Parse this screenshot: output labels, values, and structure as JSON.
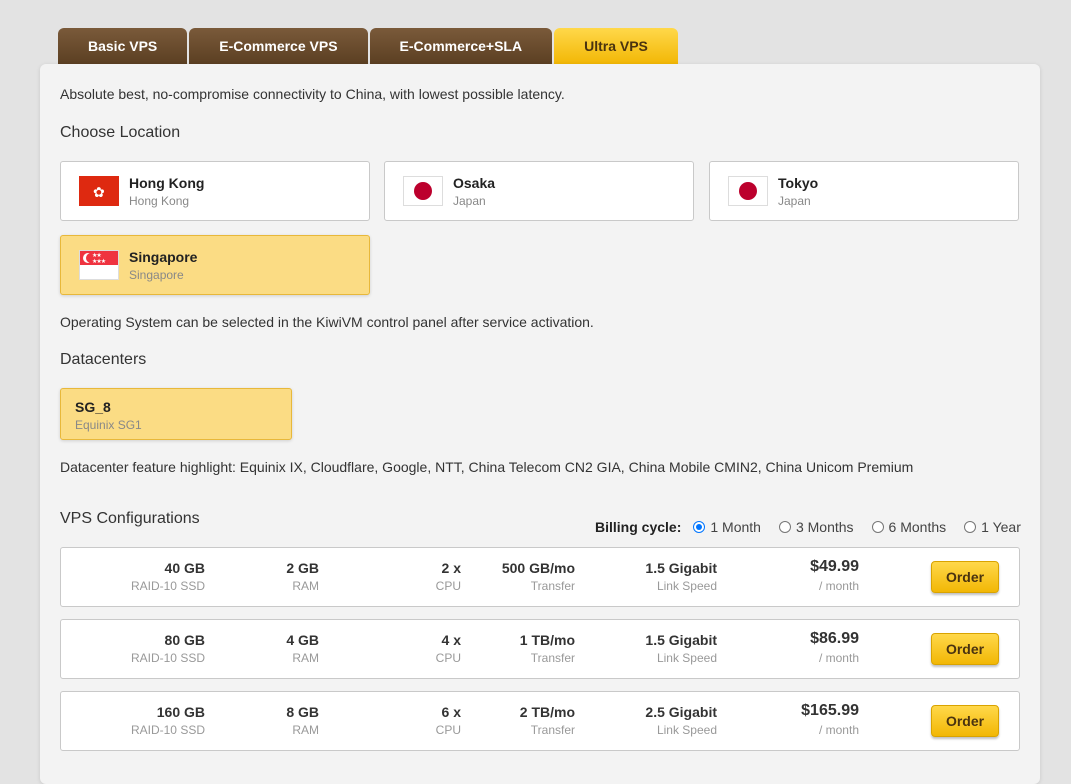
{
  "tabs": [
    {
      "label": "Basic VPS"
    },
    {
      "label": "E-Commerce VPS"
    },
    {
      "label": "E-Commerce+SLA"
    },
    {
      "label": "Ultra VPS",
      "active": true
    }
  ],
  "description": "Absolute best, no-compromise connectivity to China, with lowest possible latency.",
  "location_title": "Choose Location",
  "locations": [
    {
      "name": "Hong Kong",
      "sub": "Hong Kong",
      "flag": "hong-kong-flag"
    },
    {
      "name": "Osaka",
      "sub": "Japan",
      "flag": "japan-flag"
    },
    {
      "name": "Tokyo",
      "sub": "Japan",
      "flag": "japan-flag"
    },
    {
      "name": "Singapore",
      "sub": "Singapore",
      "flag": "singapore-flag",
      "selected": true
    }
  ],
  "os_note": "Operating System can be selected in the KiwiVM control panel after service activation.",
  "datacenters_title": "Datacenters",
  "datacenter": {
    "name": "SG_8",
    "sub": "Equinix SG1",
    "selected": true
  },
  "dc_note": "Datacenter feature highlight: Equinix IX, Cloudflare, Google, NTT, China Telecom CN2 GIA, China Mobile CMIN2, China Unicom Premium",
  "configs_title": "VPS Configurations",
  "billing": {
    "label": "Billing cycle:",
    "options": [
      "1 Month",
      "3 Months",
      "6 Months",
      "1 Year"
    ],
    "selected": "1 Month"
  },
  "config_labels": {
    "disk": "RAID-10 SSD",
    "ram": "RAM",
    "cpu": "CPU",
    "transfer": "Transfer",
    "link": "Link Speed",
    "per": "/ month",
    "order": "Order"
  },
  "configs": [
    {
      "disk": "40 GB",
      "ram": "2 GB",
      "cpu": "2 x",
      "transfer": "500 GB/mo",
      "link": "1.5 Gigabit",
      "price": "$49.99"
    },
    {
      "disk": "80 GB",
      "ram": "4 GB",
      "cpu": "4 x",
      "transfer": "1 TB/mo",
      "link": "1.5 Gigabit",
      "price": "$86.99"
    },
    {
      "disk": "160 GB",
      "ram": "8 GB",
      "cpu": "6 x",
      "transfer": "2 TB/mo",
      "link": "2.5 Gigabit",
      "price": "$165.99"
    }
  ],
  "colors": {
    "accent": "#f2b705",
    "tab_brown": "#6b4b2c",
    "selected_bg": "#fbdc84",
    "radio": "#0075ff"
  }
}
